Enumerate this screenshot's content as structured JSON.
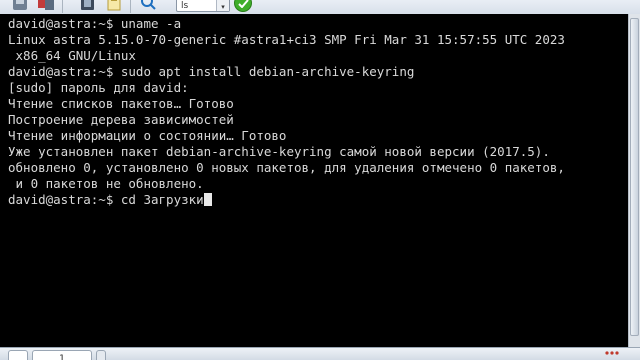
{
  "toolbar": {
    "font_select_value": "ls",
    "select_arrow": "▾",
    "buttons": [
      {
        "name": "cut-icon"
      },
      {
        "name": "copy-icon"
      },
      {
        "name": "paste-icon"
      },
      {
        "name": "search-icon"
      },
      {
        "name": "confirm-icon"
      }
    ]
  },
  "terminal": {
    "lines": [
      "david@astra:~$ uname -a",
      "Linux astra 5.15.0-70-generic #astra1+ci3 SMP Fri Mar 31 15:57:55 UTC 2023",
      " x86_64 GNU/Linux",
      "david@astra:~$ sudo apt install debian-archive-keyring",
      "[sudo] пароль для david:",
      "Чтение списков пакетов… Готово",
      "Построение дерева зависимостей",
      "Чтение информации о состоянии… Готово",
      "Уже установлен пакет debian-archive-keyring самой новой версии (2017.5).",
      "обновлено 0, установлено 0 новых пакетов, для удаления отмечено 0 пакетов,",
      " и 0 пакетов не обновлено."
    ],
    "prompt": "david@astra:~$ ",
    "current_input": "cd Загрузки"
  },
  "taskbar": {
    "tab_label": "1"
  },
  "colors": {
    "terminal_bg": "#000000",
    "terminal_fg": "#d9d9d9",
    "chrome": "#dfe4ea",
    "accent_green": "#3fae2a"
  }
}
